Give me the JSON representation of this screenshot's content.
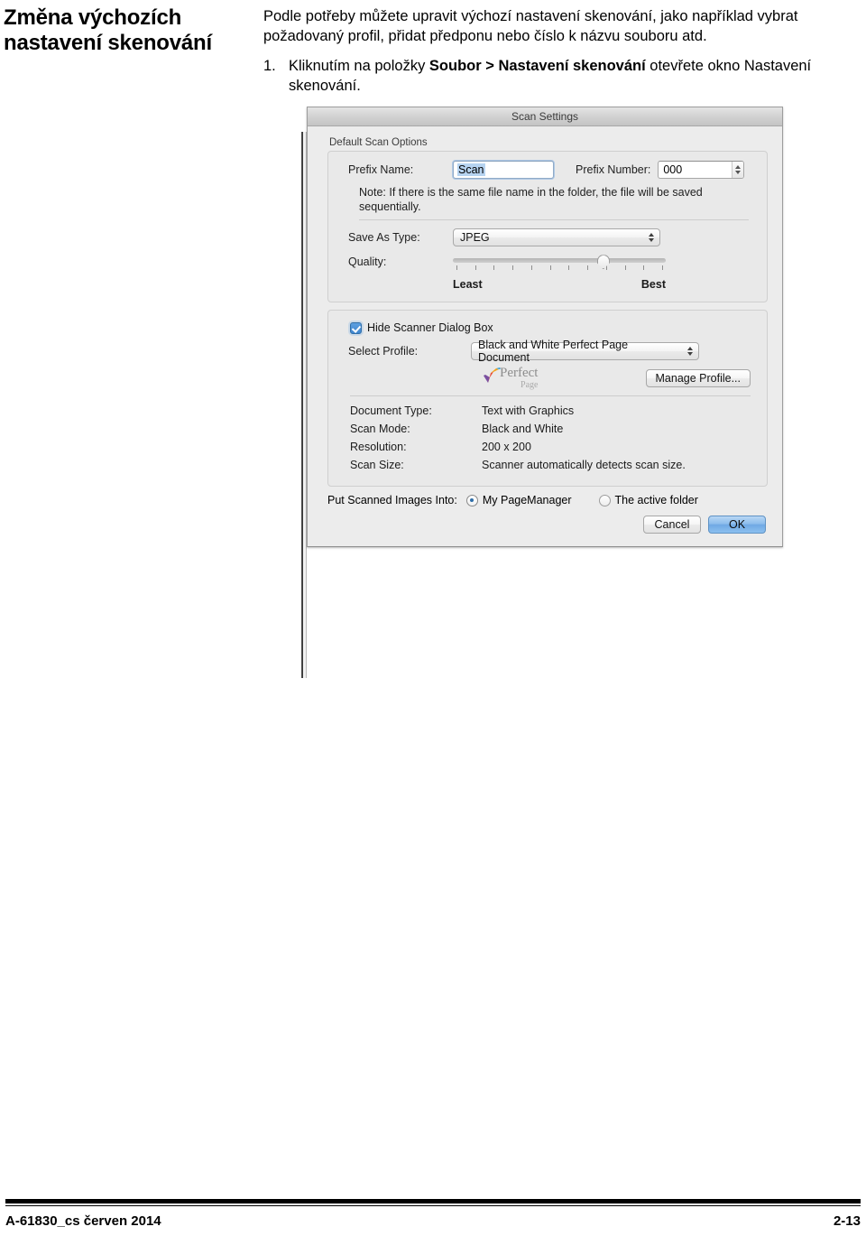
{
  "heading": {
    "line1": "Změna výchozích",
    "line2": "nastavení skenování"
  },
  "intro": "Podle potřeby můžete upravit výchozí nastavení skenování, jako například vybrat požadovaný profil, přidat předponu nebo číslo k názvu souboru atd.",
  "steps": [
    {
      "number": "1.",
      "prefix": "Kliknutím na položky ",
      "bold": "Soubor > Nastavení skenování",
      "suffix": " otevřete okno Nastavení skenování."
    }
  ],
  "dialog": {
    "title": "Scan Settings",
    "group_label": "Default Scan Options",
    "prefix_name_label": "Prefix Name:",
    "prefix_name_value": "Scan",
    "prefix_number_label": "Prefix Number:",
    "prefix_number_value": "000",
    "note": "Note: If there is the same file name in the folder, the file will be saved sequentially.",
    "save_as_type_label": "Save As Type:",
    "save_as_type_value": "JPEG",
    "quality_label": "Quality:",
    "quality_least": "Least",
    "quality_best": "Best",
    "quality_percent": 72,
    "quality_tick_count": 12,
    "hide_scanner_label": "Hide Scanner Dialog Box",
    "hide_scanner_checked": true,
    "select_profile_label": "Select Profile:",
    "select_profile_value": "Black and White Perfect Page Document",
    "manage_profile_label": "Manage Profile...",
    "logo_word_1": "Perfect",
    "logo_word_2": "Page",
    "info_rows": [
      {
        "key": "Document Type:",
        "value": "Text with Graphics"
      },
      {
        "key": "Scan Mode:",
        "value": "Black and White"
      },
      {
        "key": "Resolution:",
        "value": "200 x 200"
      },
      {
        "key": "Scan Size:",
        "value": "Scanner automatically detects scan size."
      }
    ],
    "put_images_label": "Put Scanned Images Into:",
    "radio_options": [
      {
        "label": "My PageManager",
        "selected": true
      },
      {
        "label": "The active folder",
        "selected": false
      }
    ],
    "cancel_label": "Cancel",
    "ok_label": "OK",
    "accent_color": "#6fa9e4",
    "checkbox_color": "#3f86cf"
  },
  "footer": {
    "left": "A-61830_cs  červen 2014",
    "right": "2-13"
  }
}
